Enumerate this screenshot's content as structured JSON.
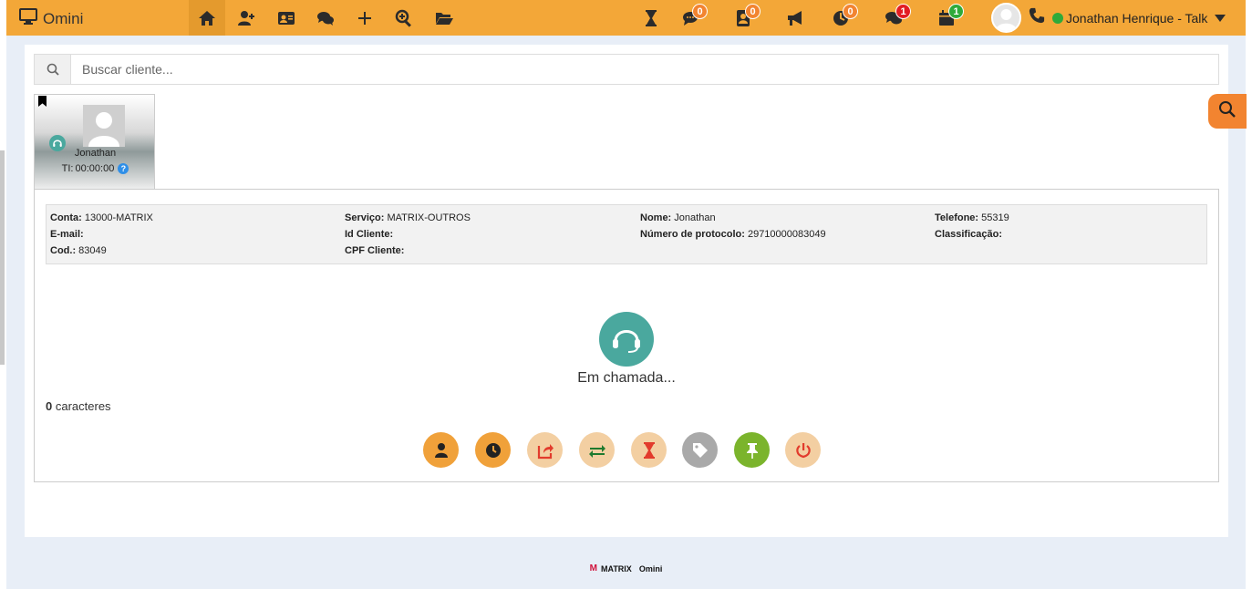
{
  "app": {
    "title": "Omini"
  },
  "nav": {
    "badges": {
      "chat_pending": "0",
      "contact_pending": "0",
      "history_pending": "0",
      "messages_unread": "1",
      "calendar_count": "1"
    },
    "user": {
      "name": "Jonathan Henrique - Talk",
      "status_color": "#2eaa3a"
    }
  },
  "search": {
    "placeholder": "Buscar cliente..."
  },
  "client_card": {
    "name": "Jonathan",
    "time_label": "TI:",
    "time_value": "00:00:00",
    "help": "?"
  },
  "info": {
    "conta_label": "Conta:",
    "conta_value": "13000-MATRIX",
    "servico_label": "Serviço:",
    "servico_value": "MATRIX-OUTROS",
    "nome_label": "Nome:",
    "nome_value": "Jonathan",
    "telefone_label": "Telefone:",
    "telefone_value": "55319",
    "email_label": "E-mail:",
    "email_value": "",
    "idcliente_label": "Id Cliente:",
    "idcliente_value": "",
    "protocolo_label": "Número de protocolo:",
    "protocolo_value": "29710000083049",
    "classificacao_label": "Classificação:",
    "classificacao_value": "",
    "cod_label": "Cod.:",
    "cod_value": "83049",
    "cpf_label": "CPF Cliente:",
    "cpf_value": ""
  },
  "call": {
    "status": "Em chamada..."
  },
  "chars": {
    "count": "0",
    "label": "caracteres"
  },
  "footer": {
    "mark": "M",
    "brand": "MATRIX",
    "product": "Omini"
  },
  "colors": {
    "navbar": "#f3a738",
    "accent_teal": "#4aa89e",
    "accent_orange": "#f28430"
  }
}
